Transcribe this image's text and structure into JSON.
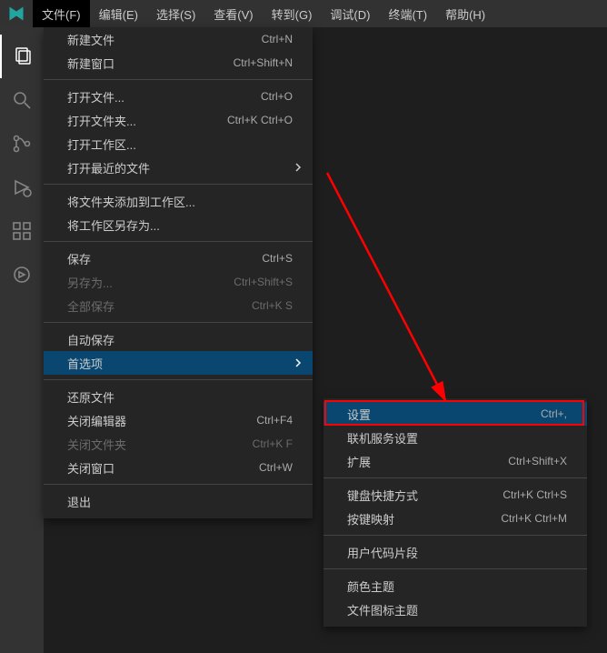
{
  "menubar": [
    "文件(F)",
    "编辑(E)",
    "选择(S)",
    "查看(V)",
    "转到(G)",
    "调试(D)",
    "终端(T)",
    "帮助(H)"
  ],
  "fileMenu": {
    "newFile": {
      "label": "新建文件",
      "shortcut": "Ctrl+N"
    },
    "newWindow": {
      "label": "新建窗口",
      "shortcut": "Ctrl+Shift+N"
    },
    "openFile": {
      "label": "打开文件...",
      "shortcut": "Ctrl+O"
    },
    "openFolder": {
      "label": "打开文件夹...",
      "shortcut": "Ctrl+K Ctrl+O"
    },
    "openWorkspace": {
      "label": "打开工作区...",
      "shortcut": ""
    },
    "openRecent": {
      "label": "打开最近的文件",
      "shortcut": ""
    },
    "addFolderToWorkspace": {
      "label": "将文件夹添加到工作区...",
      "shortcut": ""
    },
    "saveWorkspaceAs": {
      "label": "将工作区另存为...",
      "shortcut": ""
    },
    "save": {
      "label": "保存",
      "shortcut": "Ctrl+S"
    },
    "saveAs": {
      "label": "另存为...",
      "shortcut": "Ctrl+Shift+S"
    },
    "saveAll": {
      "label": "全部保存",
      "shortcut": "Ctrl+K S"
    },
    "autoSave": {
      "label": "自动保存",
      "shortcut": ""
    },
    "preferences": {
      "label": "首选项",
      "shortcut": ""
    },
    "revertFile": {
      "label": "还原文件",
      "shortcut": ""
    },
    "closeEditor": {
      "label": "关闭编辑器",
      "shortcut": "Ctrl+F4"
    },
    "closeFolder": {
      "label": "关闭文件夹",
      "shortcut": "Ctrl+K F"
    },
    "closeWindow": {
      "label": "关闭窗口",
      "shortcut": "Ctrl+W"
    },
    "exit": {
      "label": "退出",
      "shortcut": ""
    }
  },
  "preferencesMenu": {
    "settings": {
      "label": "设置",
      "shortcut": "Ctrl+,"
    },
    "onlineSettings": {
      "label": "联机服务设置",
      "shortcut": ""
    },
    "extensions": {
      "label": "扩展",
      "shortcut": "Ctrl+Shift+X"
    },
    "keyboardShortcuts": {
      "label": "键盘快捷方式",
      "shortcut": "Ctrl+K Ctrl+S"
    },
    "keymaps": {
      "label": "按键映射",
      "shortcut": "Ctrl+K Ctrl+M"
    },
    "userSnippets": {
      "label": "用户代码片段",
      "shortcut": ""
    },
    "colorTheme": {
      "label": "颜色主题",
      "shortcut": ""
    },
    "fileIconTheme": {
      "label": "文件图标主题",
      "shortcut": ""
    }
  }
}
